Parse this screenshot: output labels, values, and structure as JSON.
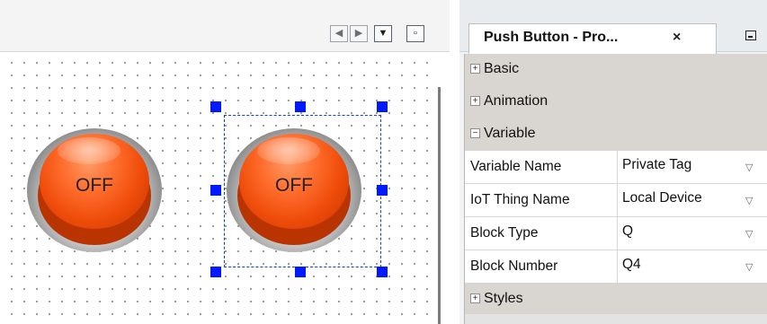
{
  "editor": {
    "buttons": [
      {
        "label": "OFF"
      },
      {
        "label": "OFF"
      }
    ],
    "toolbar": {
      "prev_icon": "chevron-left-icon",
      "next_icon": "chevron-right-icon",
      "dropdown_icon": "dropdown-icon",
      "restore_icon": "restore-window-icon"
    }
  },
  "panel": {
    "tab_title": "Push Button - Pro...",
    "close_symbol": "×",
    "categories": {
      "basic": {
        "label": "Basic",
        "expanded": false
      },
      "animation": {
        "label": "Animation",
        "expanded": false
      },
      "variable": {
        "label": "Variable",
        "expanded": true
      },
      "styles": {
        "label": "Styles",
        "expanded": false
      }
    },
    "properties": [
      {
        "name": "Variable Name",
        "value": "Private Tag"
      },
      {
        "name": "IoT Thing Name",
        "value": "Local Device"
      },
      {
        "name": "Block Type",
        "value": "Q"
      },
      {
        "name": "Block Number",
        "value": "Q4"
      }
    ]
  },
  "colors": {
    "selection": "#0019ff",
    "button_red": "#ef4c0a",
    "category_bg": "#d9d6d2"
  }
}
